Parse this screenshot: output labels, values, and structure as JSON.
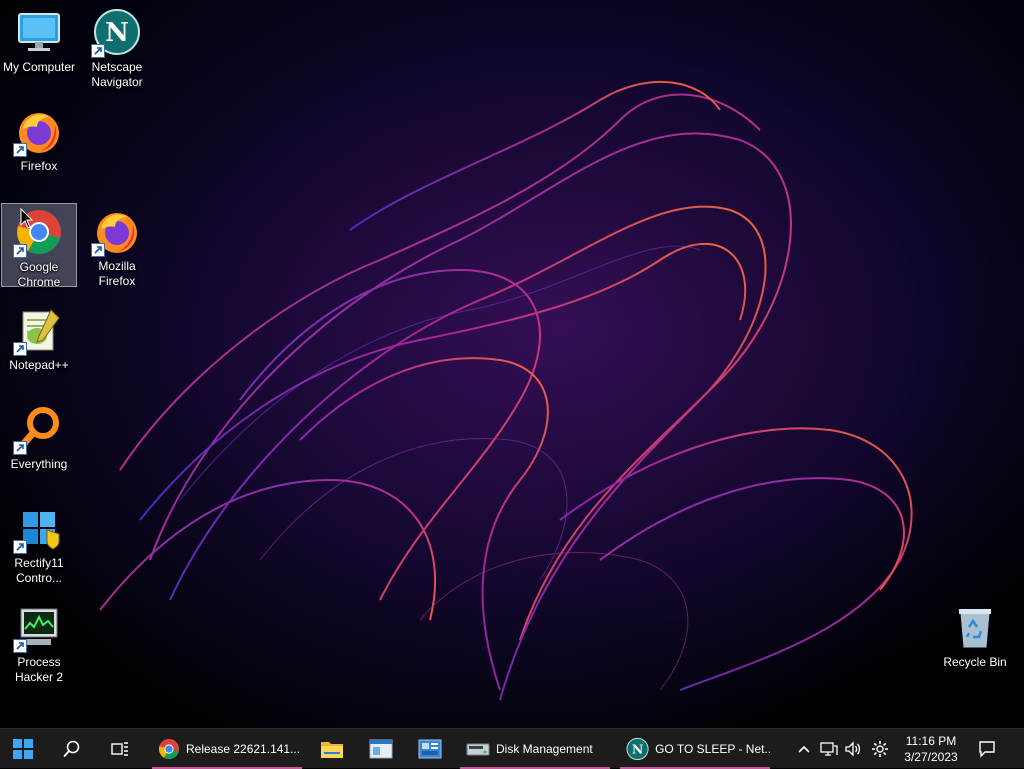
{
  "desktop": {
    "icons": [
      {
        "label": "My Computer",
        "icon": "computer-icon",
        "shortcut": false
      },
      {
        "label": "Netscape\nNavigator",
        "icon": "netscape-icon",
        "shortcut": true
      },
      {
        "label": "Firefox",
        "icon": "firefox-icon",
        "shortcut": true
      },
      {
        "label": "Google\nChrome",
        "icon": "chrome-icon",
        "shortcut": true,
        "selected": true
      },
      {
        "label": "Mozilla\nFirefox",
        "icon": "firefox-icon",
        "shortcut": true
      },
      {
        "label": "Notepad++",
        "icon": "notepadpp-icon",
        "shortcut": true
      },
      {
        "label": "Everything",
        "icon": "everything-icon",
        "shortcut": true
      },
      {
        "label": "Rectify11\nContro...",
        "icon": "rectify11-icon",
        "shortcut": true
      },
      {
        "label": "Process\nHacker 2",
        "icon": "process-hacker-icon",
        "shortcut": true
      },
      {
        "label": "Recycle Bin",
        "icon": "recycle-bin-icon",
        "shortcut": false
      }
    ]
  },
  "taskbar": {
    "start_icon": "windows-start-icon",
    "search_icon": "search-icon",
    "taskview_icon": "task-view-icon",
    "apps": [
      {
        "label": "Release 22621.141...",
        "icon": "chrome-icon",
        "running": true
      },
      {
        "label": "",
        "icon": "file-explorer-icon",
        "running": false
      },
      {
        "label": "",
        "icon": "window-app-icon",
        "running": false
      },
      {
        "label": "",
        "icon": "control-panel-icon",
        "running": false
      },
      {
        "label": "Disk Management",
        "icon": "disk-management-icon",
        "running": true
      },
      {
        "label": "GO TO SLEEP - Net...",
        "icon": "netscape-icon",
        "running": true
      }
    ],
    "tray": {
      "chevron_icon": "chevron-up-icon",
      "network_icon": "network-icon",
      "volume_icon": "volume-icon",
      "settings_icon": "gear-icon",
      "time": "11:16 PM",
      "date": "3/27/2023",
      "notification_icon": "notification-icon"
    },
    "accent_color": "#c8579e"
  }
}
